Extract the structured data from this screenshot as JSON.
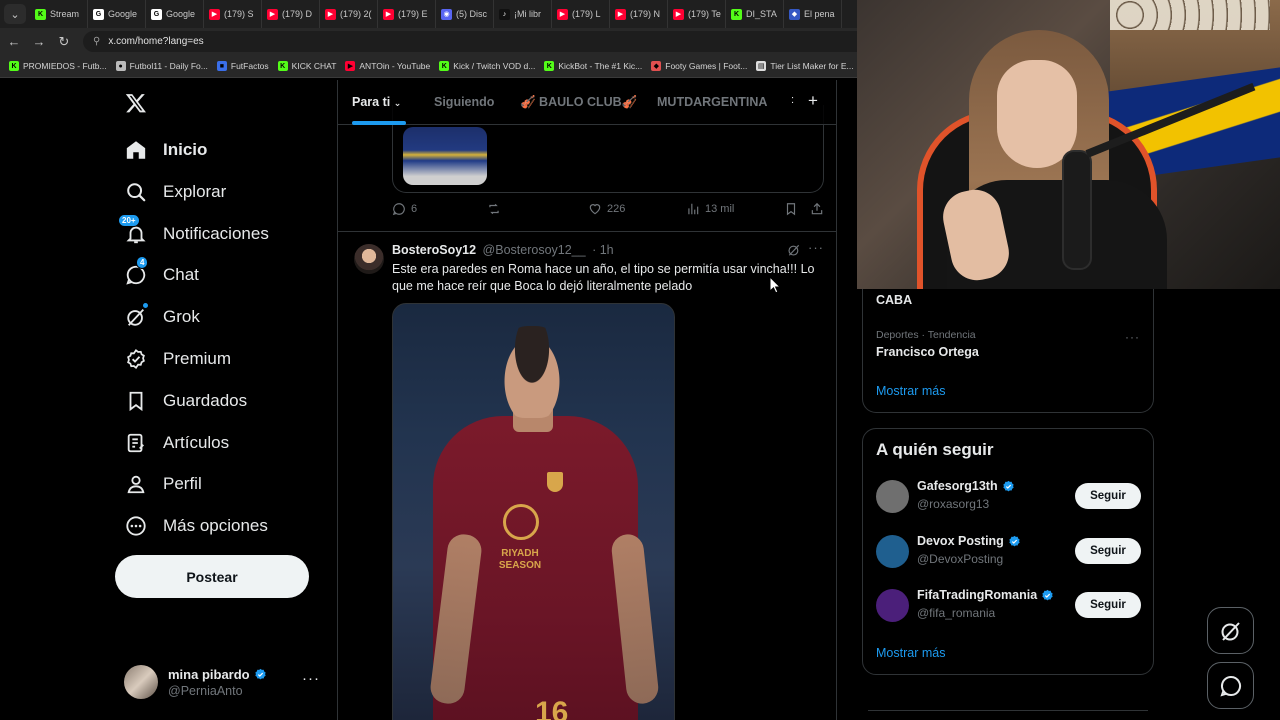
{
  "browser": {
    "menu_icon": "chevron-down-icon",
    "tabs": [
      {
        "label": "Stream",
        "icon": "kick-icon",
        "color": "#53fc18"
      },
      {
        "label": "Google",
        "icon": "google-icon",
        "color": "#ffffff"
      },
      {
        "label": "Google",
        "icon": "google-icon",
        "color": "#ffffff"
      },
      {
        "label": "(179) S",
        "icon": "youtube-icon",
        "color": "#ff0033"
      },
      {
        "label": "(179) D",
        "icon": "youtube-icon",
        "color": "#ff0033"
      },
      {
        "label": "(179) 2(",
        "icon": "youtube-icon",
        "color": "#ff0033"
      },
      {
        "label": "(179) E",
        "icon": "youtube-icon",
        "color": "#ff0033"
      },
      {
        "label": "(5) Disc",
        "icon": "discord-icon",
        "color": "#5865f2"
      },
      {
        "label": "¡Mi libr",
        "icon": "tiktok-icon",
        "color": "#111111"
      },
      {
        "label": "(179) L",
        "icon": "youtube-icon",
        "color": "#ff0033"
      },
      {
        "label": "(179) N",
        "icon": "youtube-icon",
        "color": "#ff0033"
      },
      {
        "label": "(179) Te",
        "icon": "youtube-icon",
        "color": "#ff0033"
      },
      {
        "label": "DI_STA",
        "icon": "kick-icon",
        "color": "#53fc18"
      },
      {
        "label": "El pena",
        "icon": "site-icon",
        "color": "#3558c4"
      }
    ],
    "url": "x.com/home?lang=es",
    "bookmarks": [
      {
        "label": "PROMIEDOS - Futb...",
        "icon": "kick-icon",
        "color": "#53fc18"
      },
      {
        "label": "Futbol11 - Daily Fo...",
        "icon": "ball-icon",
        "color": "#bbbbbb"
      },
      {
        "label": "FutFactos",
        "icon": "bookmark-icon",
        "color": "#3a6ee8"
      },
      {
        "label": "KICK CHAT",
        "icon": "kick-icon",
        "color": "#53fc18"
      },
      {
        "label": "ANTOin - YouTube",
        "icon": "youtube-icon",
        "color": "#ff0033"
      },
      {
        "label": "Kick / Twitch VOD d...",
        "icon": "kick-icon",
        "color": "#53fc18"
      },
      {
        "label": "KickBot - The #1 Kic...",
        "icon": "kick-icon",
        "color": "#53fc18"
      },
      {
        "label": "Footy Games | Foot...",
        "icon": "site-icon",
        "color": "#e05050"
      },
      {
        "label": "Tier List Maker for E...",
        "icon": "tierlist-icon",
        "color": "#dddddd"
      }
    ]
  },
  "nav": {
    "items": [
      {
        "label": "Inicio",
        "icon": "home-icon",
        "active": true
      },
      {
        "label": "Explorar",
        "icon": "search-icon"
      },
      {
        "label": "Notificaciones",
        "icon": "bell-icon",
        "badge": "20+"
      },
      {
        "label": "Chat",
        "icon": "chat-icon",
        "badge": "4"
      },
      {
        "label": "Grok",
        "icon": "grok-icon"
      },
      {
        "label": "Premium",
        "icon": "verified-badge-icon"
      },
      {
        "label": "Guardados",
        "icon": "bookmark-icon"
      },
      {
        "label": "Artículos",
        "icon": "articles-icon"
      },
      {
        "label": "Perfil",
        "icon": "person-icon"
      },
      {
        "label": "Más opciones",
        "icon": "more-circle-icon"
      }
    ],
    "post_label": "Postear",
    "account": {
      "name": "mina pibardo",
      "handle": "@PerniaAnto"
    }
  },
  "timeline": {
    "tabs": [
      "Para ti",
      "Siguiendo",
      "🎻 BAULO CLUB🎻",
      "MUTDARGENTINA"
    ],
    "prev_tweet_actions": {
      "replies": "6",
      "likes": "226",
      "views": "13 mil"
    },
    "tweet": {
      "name": "BosteroSoy12",
      "handle": "@Bosterosoy12__",
      "time": "· 1h",
      "text": "Este era paredes en Roma hace un año, el tipo se permitía usar vincha!!! Lo que me hace reír que Boca lo dejó literalmente pelado",
      "photo_text": {
        "sponsor": "RIYADH SEASON",
        "number": "16"
      }
    }
  },
  "sidebar": {
    "trend_prev_location": "CABA",
    "trend": {
      "category": "Deportes · Tendencia",
      "name": "Francisco Ortega"
    },
    "show_more": "Mostrar más",
    "who_to_follow_title": "A quién seguir",
    "follow_label": "Seguir",
    "suggestions": [
      {
        "name": "Gafesorg13th",
        "handle": "@roxasorg13",
        "color": "#6f6f6f"
      },
      {
        "name": "Devox Posting",
        "handle": "@DevoxPosting",
        "color": "#1f5f8f"
      },
      {
        "name": "FifaTradingRomania",
        "handle": "@fifa_romania",
        "color": "#4b1f7a"
      }
    ]
  },
  "colors": {
    "accent": "#1d9bf0",
    "background": "#000000",
    "text": "#e7e9ea",
    "muted": "#71767b"
  }
}
